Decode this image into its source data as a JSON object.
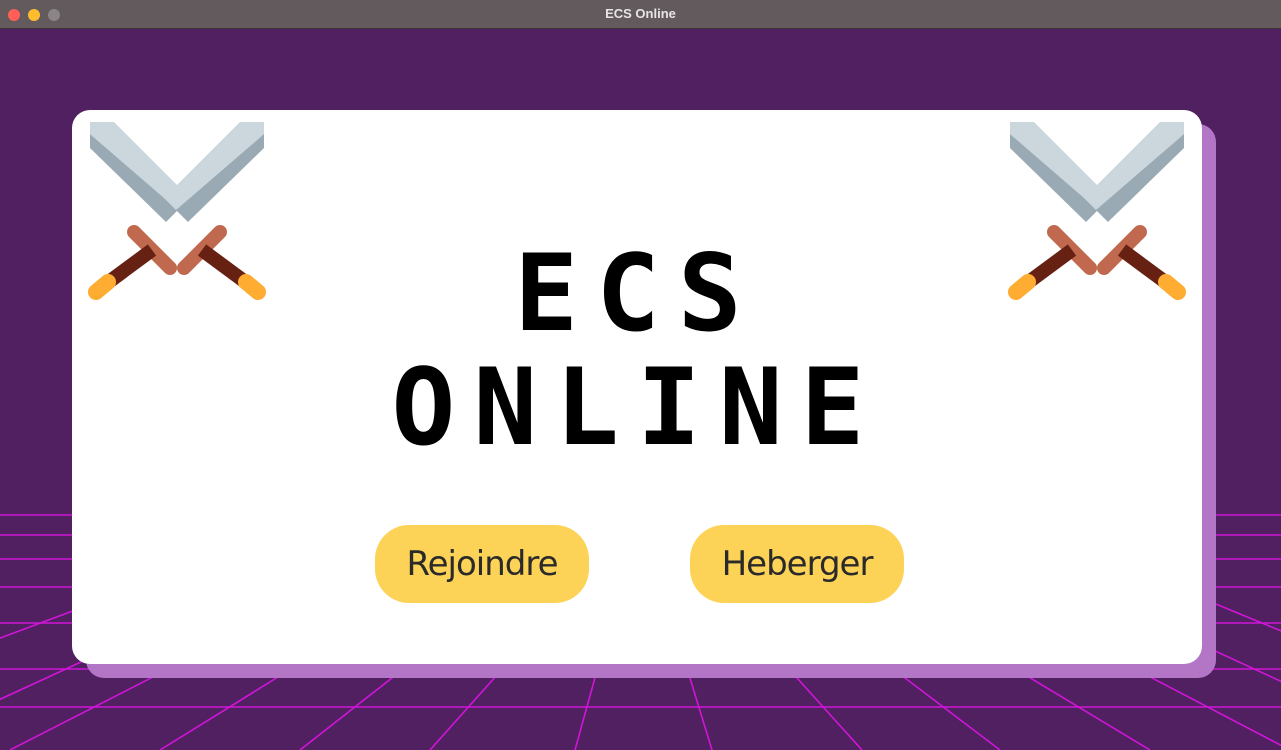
{
  "window": {
    "title": "ECS Online"
  },
  "logo": {
    "line1": "ECS",
    "line2": "ONLINE"
  },
  "buttons": {
    "join_label": "Rejoindre",
    "host_label": "Heberger"
  },
  "icons": {
    "left": "crossed-swords-icon",
    "right": "crossed-swords-icon"
  },
  "colors": {
    "background": "#502060",
    "card": "#ffffff",
    "card_shadow": "#b376c6",
    "button": "#fcd356",
    "grid_line": "#d015d8"
  }
}
